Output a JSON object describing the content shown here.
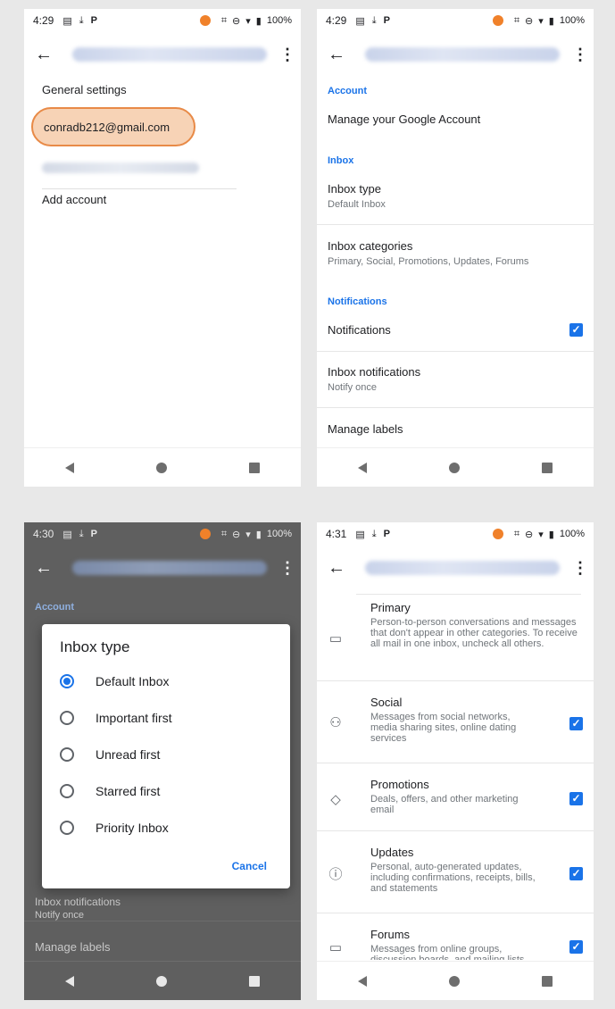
{
  "panel1": {
    "status": {
      "time": "4:29",
      "battery": "100%"
    },
    "general_settings": "General settings",
    "highlighted_account": "conradb212@gmail.com",
    "add_account": "Add account"
  },
  "panel2": {
    "status": {
      "time": "4:29",
      "battery": "100%"
    },
    "section_account": "Account",
    "manage_google": "Manage your Google Account",
    "section_inbox": "Inbox",
    "inbox_type_title": "Inbox type",
    "inbox_type_value": "Default Inbox",
    "inbox_categories_title": "Inbox categories",
    "inbox_categories_value": "Primary, Social, Promotions, Updates, Forums",
    "section_notifications": "Notifications",
    "notifications_title": "Notifications",
    "inbox_notifications_title": "Inbox notifications",
    "inbox_notifications_value": "Notify once",
    "manage_labels": "Manage labels",
    "notifications_checked": true
  },
  "panel3": {
    "status": {
      "time": "4:30",
      "battery": "100%"
    },
    "bg_section_account": "Account",
    "bg_inbox_notifications": "Inbox notifications",
    "bg_notify_once": "Notify once",
    "bg_manage_labels": "Manage labels",
    "dialog": {
      "title": "Inbox type",
      "options": [
        {
          "label": "Default Inbox",
          "selected": true
        },
        {
          "label": "Important first",
          "selected": false
        },
        {
          "label": "Unread first",
          "selected": false
        },
        {
          "label": "Starred first",
          "selected": false
        },
        {
          "label": "Priority Inbox",
          "selected": false
        }
      ],
      "cancel": "Cancel"
    }
  },
  "panel4": {
    "status": {
      "time": "4:31",
      "battery": "100%"
    },
    "categories": [
      {
        "name": "Primary",
        "icon": "inbox-icon",
        "desc": "Person-to-person conversations and messages that don't appear in other categories. To receive all mail in one inbox, uncheck all others.",
        "checked": null
      },
      {
        "name": "Social",
        "icon": "people-icon",
        "desc": "Messages from social networks, media sharing sites, online dating services",
        "checked": true
      },
      {
        "name": "Promotions",
        "icon": "tag-icon",
        "desc": "Deals, offers, and other marketing email",
        "checked": true
      },
      {
        "name": "Updates",
        "icon": "info-icon",
        "desc": "Personal, auto-generated updates, including confirmations, receipts, bills, and statements",
        "checked": true
      },
      {
        "name": "Forums",
        "icon": "forum-icon",
        "desc": "Messages from online groups, discussion boards, and mailing lists",
        "checked": true
      }
    ]
  },
  "colors": {
    "accent": "#1a73e8",
    "highlight_fill": "#f7d3b6",
    "highlight_border": "#e88a47",
    "status_dot": "#f0812a",
    "scrim": "#5f5f5f"
  }
}
